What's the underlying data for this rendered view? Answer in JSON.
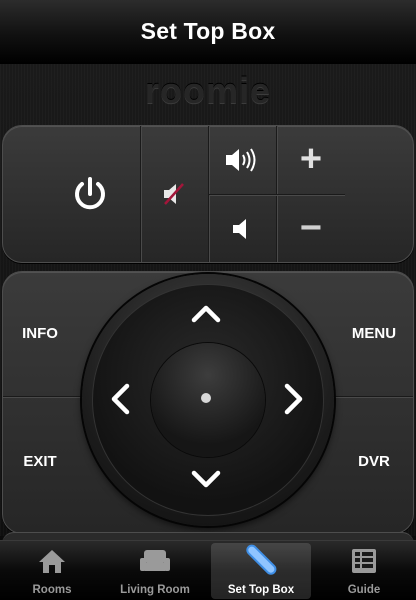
{
  "header": {
    "title": "Set Top Box"
  },
  "brand": {
    "logo_text": "roomie"
  },
  "top_panel": {
    "power_icon": "power-icon",
    "mute_icon": "mute-icon",
    "volume_up_icon": "speaker-loud-icon",
    "volume_down_icon": "speaker-low-icon",
    "channel_up_label": "+",
    "channel_down_label": "−"
  },
  "nav_panel": {
    "info_label": "INFO",
    "menu_label": "MENU",
    "exit_label": "EXIT",
    "dvr_label": "DVR"
  },
  "tabs": [
    {
      "label": "Rooms",
      "icon": "house-icon",
      "selected": false
    },
    {
      "label": "Living Room",
      "icon": "sofa-icon",
      "selected": false
    },
    {
      "label": "Set Top Box",
      "icon": "remote-icon",
      "selected": true
    },
    {
      "label": "Guide",
      "icon": "grid-icon",
      "selected": false
    }
  ],
  "colors": {
    "accent_blue": "#3f8fe6",
    "background": "#0b0b0b",
    "text": "#ffffff"
  }
}
